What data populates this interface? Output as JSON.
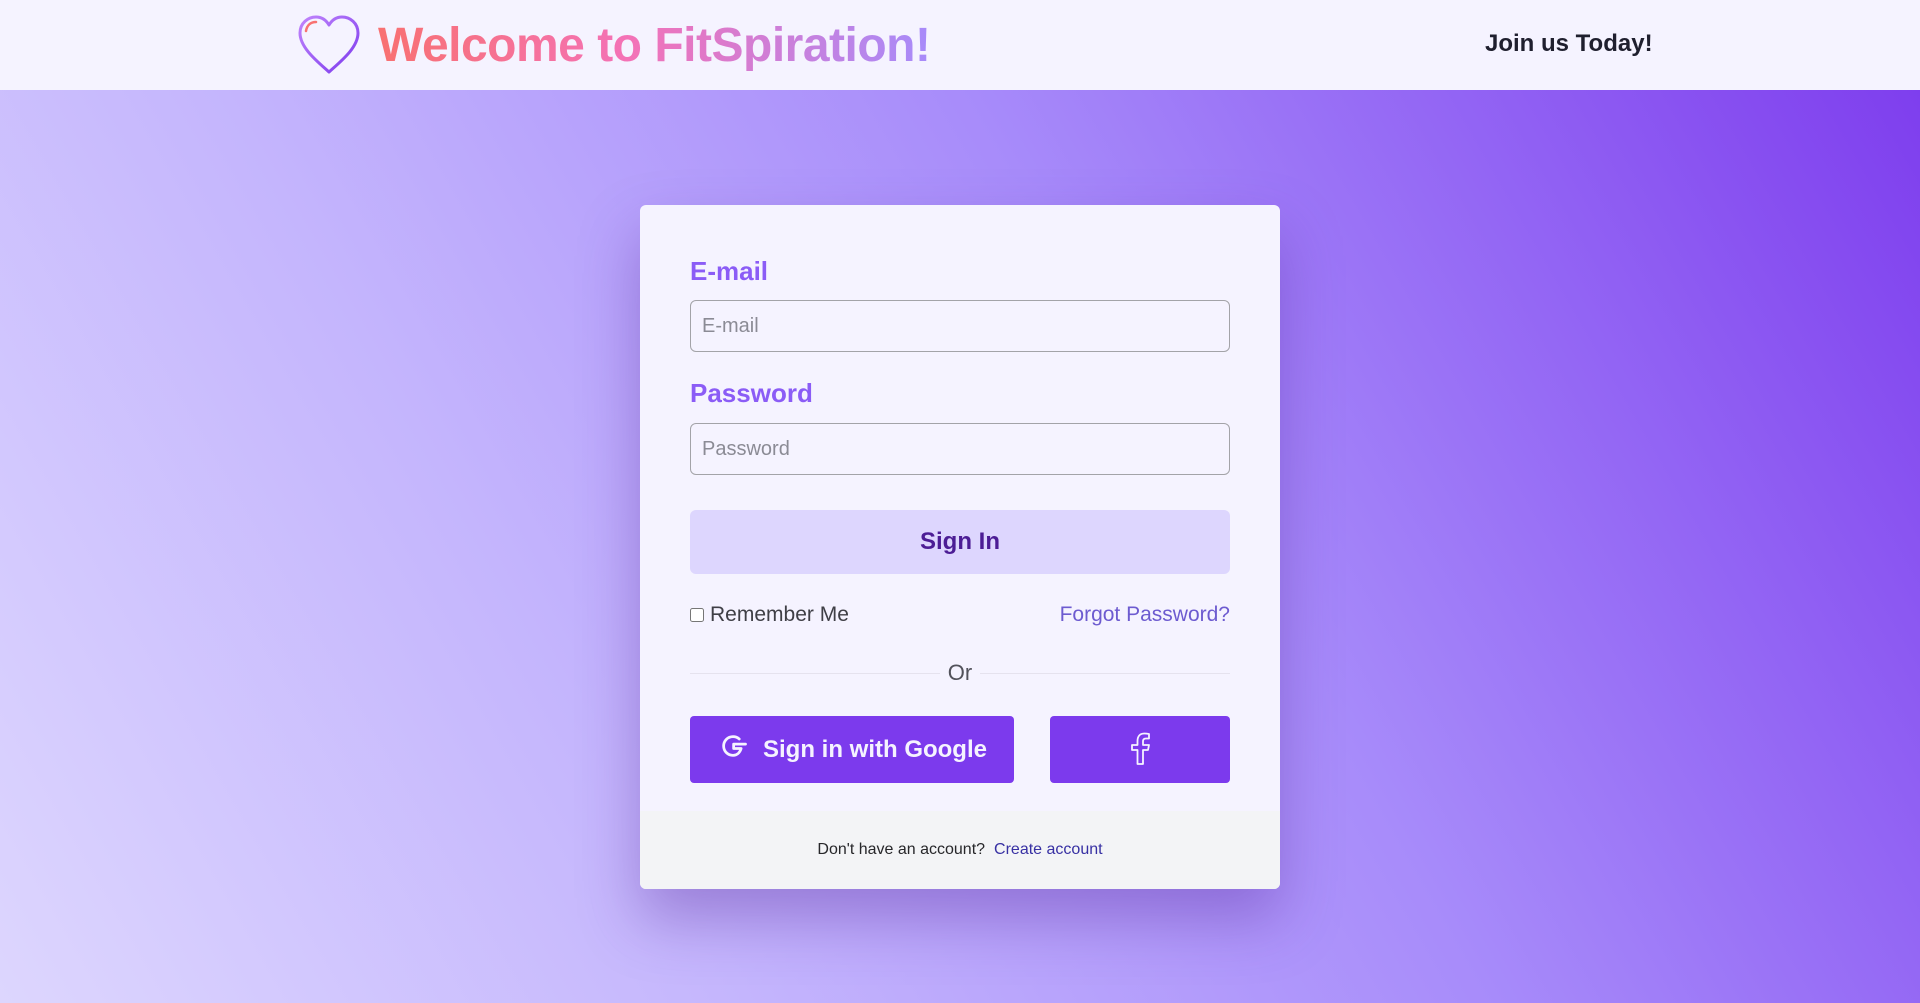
{
  "header": {
    "title": "Welcome to FitSpiration!",
    "logo_icon": "heart-icon",
    "join_label": "Join us Today!"
  },
  "login_form": {
    "email_label": "E-mail",
    "email_placeholder": "E-mail",
    "email_value": "",
    "password_label": "Password",
    "password_placeholder": "Password",
    "password_value": "",
    "signin_label": "Sign In",
    "remember_label": "Remember Me",
    "remember_checked": false,
    "forgot_label": "Forgot Password?",
    "divider_label": "Or",
    "google_label": "Sign in with Google",
    "google_icon": "google-icon",
    "facebook_icon": "facebook-icon"
  },
  "footer": {
    "prompt": "Don't have an account?",
    "create_label": "Create account"
  },
  "colors": {
    "accent": "#7c3aed",
    "label": "#8b5cf6",
    "card_bg": "#f5f3ff",
    "signin_bg": "#ddd6fe",
    "brand_gradient_start": "#f87171",
    "brand_gradient_end": "#a78bfa"
  }
}
